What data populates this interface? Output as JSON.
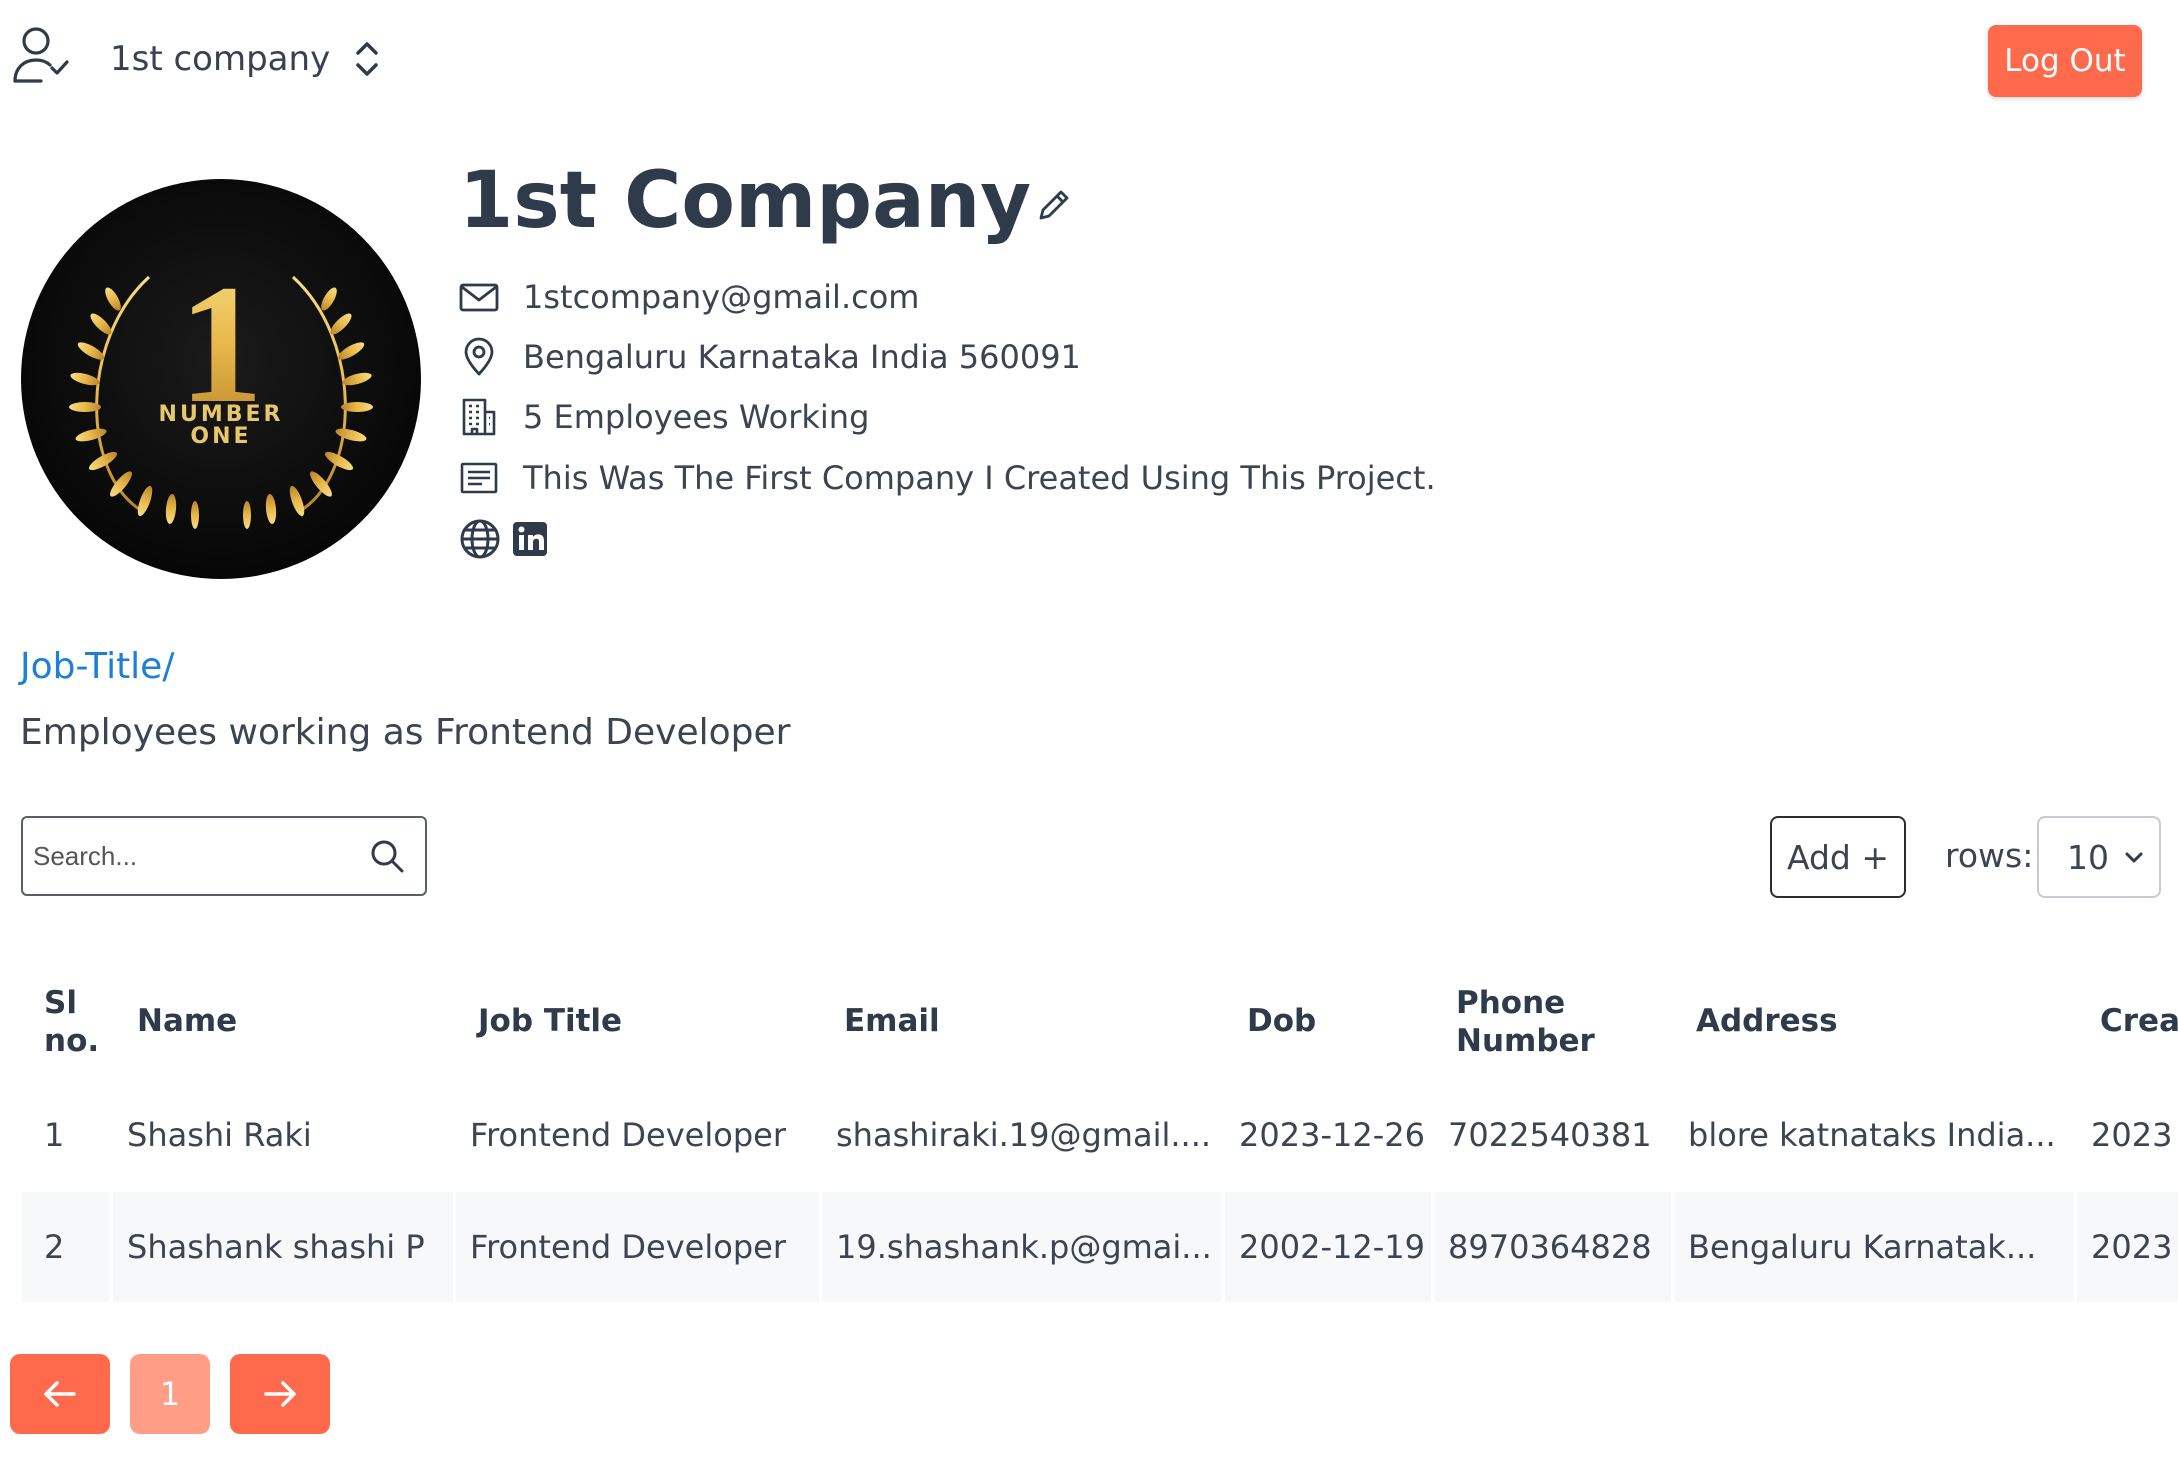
{
  "header": {
    "company_selector": "1st company",
    "logout_label": "Log Out"
  },
  "profile": {
    "logo_top_text": "NUMBER",
    "logo_bottom_text": "ONE",
    "logo_numeral": "1",
    "name": "1st Company",
    "email": "1stcompany@gmail.com",
    "address": "Bengaluru Karnataka India 560091",
    "employees": "5 Employees Working",
    "description": "This Was The First Company I Created Using This Project."
  },
  "section": {
    "breadcrumb": "Job-Title/",
    "title": "Employees working as Frontend Developer"
  },
  "controls": {
    "search_placeholder": "Search...",
    "add_label": "Add +",
    "rows_label": "rows:",
    "rows_value": "10"
  },
  "table": {
    "headers": {
      "sl_line1": "Sl",
      "sl_line2": "no.",
      "name": "Name",
      "job_title": "Job Title",
      "email": "Email",
      "dob": "Dob",
      "phone_line1": "Phone",
      "phone_line2": "Number",
      "address": "Address",
      "created": "Creat"
    },
    "rows": [
      {
        "sl": "1",
        "name": "Shashi Raki",
        "job_title": "Frontend Developer",
        "email": "shashiraki.19@gmail....",
        "dob": "2023-12-26",
        "phone": "7022540381",
        "address": "blore katnataks India...",
        "created": "2023"
      },
      {
        "sl": "2",
        "name": "Shashank shashi P",
        "job_title": "Frontend Developer",
        "email": "19.shashank.p@gmai...",
        "dob": "2002-12-19",
        "phone": "8970364828",
        "address": "Bengaluru Karnatak...",
        "created": "2023"
      }
    ]
  },
  "pagination": {
    "current_page": "1"
  },
  "colors": {
    "accent": "#ff6a4d",
    "link": "#1f7fd8",
    "gold": "#e8b84a"
  }
}
